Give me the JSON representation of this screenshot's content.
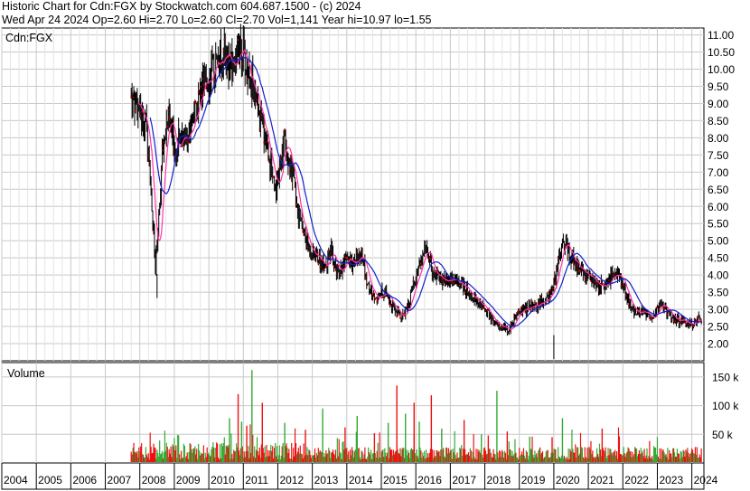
{
  "header": {
    "line1": "Historic Chart for Cdn:FGX by Stockwatch.com 604.687.1500 - (c) 2024",
    "line2": "Wed Apr 24 2024   Op=2.60  Hi=2.70  Lo=2.60  Cl=2.70  Vol=1,141  Year hi=10.97  lo=1.55"
  },
  "colors": {
    "up_volume": "#33aa33",
    "down_volume": "#ee1111",
    "price_bar": "#000000",
    "close_dots": "#dd0000",
    "ma_short": "#ff33aa",
    "ma_long": "#1122cc",
    "grid": "#c8c8c8",
    "background": "#ffffff"
  },
  "chart_data": [
    {
      "type": "line",
      "title": "Cdn:FGX",
      "ylabel": "",
      "ylim": [
        1.5,
        11.2
      ],
      "y_tick_labels": [
        "2.00",
        "2.50",
        "3.00",
        "3.50",
        "4.00",
        "4.50",
        "5.00",
        "5.50",
        "6.00",
        "6.50",
        "7.00",
        "7.50",
        "8.00",
        "8.50",
        "9.00",
        "9.50",
        "10.00",
        "10.50",
        "11.00"
      ],
      "xlim": [
        2004.0,
        2024.35
      ],
      "x_tick_labels": [
        "2004",
        "2005",
        "2006",
        "2007",
        "2008",
        "2009",
        "2010",
        "2011",
        "2012",
        "2013",
        "2014",
        "2015",
        "2016",
        "2017",
        "2018",
        "2019",
        "2020",
        "2021",
        "2022",
        "2023",
        "2024"
      ],
      "grid": true,
      "series": [
        {
          "role": "close",
          "x": [
            2007.75,
            2007.85,
            2007.95,
            2008.05,
            2008.15,
            2008.25,
            2008.35,
            2008.45,
            2008.55,
            2008.65,
            2008.75,
            2008.85,
            2008.95,
            2009.05,
            2009.15,
            2009.3,
            2009.45,
            2009.6,
            2009.75,
            2009.9,
            2010.05,
            2010.2,
            2010.35,
            2010.5,
            2010.65,
            2010.8,
            2010.95,
            2011.05,
            2011.15,
            2011.25,
            2011.35,
            2011.45,
            2011.55,
            2011.65,
            2011.8,
            2011.95,
            2012.1,
            2012.2,
            2012.3,
            2012.4,
            2012.5,
            2012.6,
            2012.75,
            2012.9,
            2013.05,
            2013.15,
            2013.25,
            2013.4,
            2013.55,
            2013.7,
            2013.85,
            2014.0,
            2014.15,
            2014.3,
            2014.45,
            2014.55,
            2014.7,
            2014.85,
            2015.0,
            2015.15,
            2015.3,
            2015.45,
            2015.6,
            2015.75,
            2015.9,
            2016.05,
            2016.15,
            2016.3,
            2016.45,
            2016.6,
            2016.75,
            2016.9,
            2017.05,
            2017.2,
            2017.35,
            2017.5,
            2017.65,
            2017.8,
            2017.95,
            2018.1,
            2018.25,
            2018.4,
            2018.55,
            2018.7,
            2018.85,
            2019.0,
            2019.15,
            2019.3,
            2019.45,
            2019.6,
            2019.75,
            2019.85,
            2019.95,
            2020.05,
            2020.15,
            2020.25,
            2020.35,
            2020.45,
            2020.55,
            2020.7,
            2020.85,
            2021.0,
            2021.15,
            2021.3,
            2021.45,
            2021.6,
            2021.75,
            2021.9,
            2022.0,
            2022.1,
            2022.25,
            2022.4,
            2022.55,
            2022.7,
            2022.85,
            2023.0,
            2023.15,
            2023.3,
            2023.45,
            2023.6,
            2023.75,
            2023.9,
            2024.05,
            2024.2,
            2024.3
          ],
          "values": [
            9.2,
            9.1,
            8.9,
            8.6,
            8.5,
            7.8,
            6.0,
            4.2,
            5.5,
            7.5,
            8.3,
            8.5,
            8.0,
            7.6,
            8.0,
            8.1,
            8.3,
            8.8,
            9.3,
            9.6,
            9.9,
            10.1,
            10.3,
            10.5,
            10.0,
            10.4,
            10.6,
            10.2,
            9.9,
            9.6,
            9.0,
            8.6,
            8.3,
            8.0,
            7.2,
            6.5,
            7.3,
            8.0,
            7.6,
            7.0,
            6.4,
            5.8,
            5.2,
            4.8,
            4.6,
            4.5,
            4.4,
            4.3,
            4.7,
            4.1,
            4.2,
            4.4,
            4.3,
            4.5,
            4.6,
            3.9,
            3.5,
            3.3,
            3.5,
            3.4,
            3.1,
            2.9,
            2.8,
            3.1,
            3.6,
            4.0,
            4.5,
            4.8,
            4.2,
            3.9,
            3.9,
            3.8,
            3.9,
            3.8,
            3.7,
            3.6,
            3.4,
            3.2,
            3.1,
            2.9,
            2.6,
            2.5,
            2.4,
            2.4,
            2.7,
            2.9,
            3.0,
            3.1,
            3.1,
            3.2,
            3.3,
            3.4,
            3.5,
            3.9,
            4.6,
            5.0,
            4.9,
            4.6,
            4.5,
            4.3,
            4.0,
            3.9,
            3.8,
            3.7,
            3.7,
            3.9,
            4.1,
            4.0,
            3.7,
            3.4,
            3.0,
            2.9,
            2.9,
            2.9,
            2.8,
            3.0,
            3.1,
            2.9,
            2.8,
            2.7,
            2.7,
            2.6,
            2.6,
            2.7,
            2.7
          ]
        }
      ]
    },
    {
      "type": "bar",
      "title": "Volume",
      "ylim": [
        0,
        175000
      ],
      "y_tick_labels": [
        "50 k",
        "100 k",
        "150 k"
      ],
      "xlim": [
        2004.0,
        2024.35
      ],
      "series": [
        {
          "role": "volume",
          "x": [
            2010.6,
            2010.85,
            2010.95,
            2011.1,
            2011.25,
            2011.55,
            2012.2,
            2012.8,
            2013.3,
            2013.95,
            2014.3,
            2014.8,
            2015.2,
            2015.45,
            2015.7,
            2015.95,
            2016.1,
            2016.45,
            2016.75,
            2017.4,
            2017.9,
            2018.1,
            2018.35,
            2018.65,
            2019.3,
            2019.95,
            2020.25,
            2021.4
          ],
          "values": [
            78000,
            120000,
            72000,
            65000,
            162000,
            105000,
            70000,
            58000,
            95000,
            62000,
            82000,
            52000,
            70000,
            135000,
            86000,
            105000,
            72000,
            118000,
            60000,
            75000,
            50000,
            48000,
            126000,
            55000,
            46000,
            45000,
            78000,
            60000
          ]
        }
      ]
    }
  ]
}
